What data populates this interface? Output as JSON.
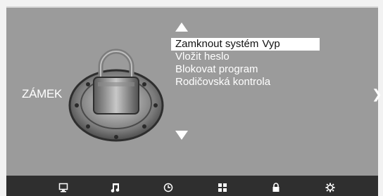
{
  "category": {
    "label": "ZÁMEK",
    "illustration_icon": "padlock-manhole-icon"
  },
  "menu": {
    "up_icon": "up-arrow-icon",
    "down_icon": "down-arrow-icon",
    "items": [
      {
        "label": "Zamknout systém",
        "value": "Vyp",
        "selected": true
      },
      {
        "label": "Vložit heslo",
        "selected": false
      },
      {
        "label": "Blokovat program",
        "selected": false
      },
      {
        "label": "Rodičovská kontrola",
        "selected": false
      }
    ]
  },
  "nav": {
    "next_glyph": "❯",
    "next_icon": "next-page-icon"
  },
  "bottom_bar": {
    "icons": [
      "monitor-icon",
      "music-icon",
      "clock-icon",
      "grid-icon",
      "lock-icon",
      "gear-icon"
    ],
    "active_icon": "lock-icon"
  },
  "colors": {
    "screen_bg": "#9b9b9b",
    "bar_bg": "#2f2f2f",
    "highlight": "#ffffff"
  }
}
